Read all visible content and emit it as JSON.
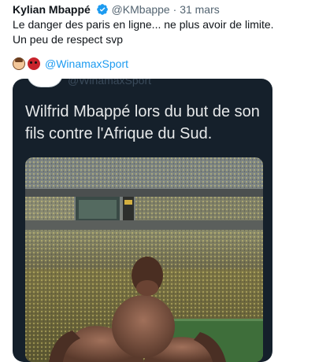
{
  "tweet": {
    "author_name": "Kylian Mbappé",
    "handle": "@KMbappe",
    "separator": "·",
    "date": "31 mars",
    "lines": [
      "Le danger des paris en ligne... ne plus avoir de limite.",
      "Un peu de respect svp"
    ],
    "mention": "@WinamaxSport"
  },
  "quoted": {
    "handle_partial": "@WinamaxSport",
    "text": "Wilfrid Mbappé lors du but de son fils contre l'Afrique du Sud."
  },
  "colors": {
    "link": "#1d9bf0",
    "card_bg": "#15202b",
    "verified": "#1d9bf0"
  }
}
